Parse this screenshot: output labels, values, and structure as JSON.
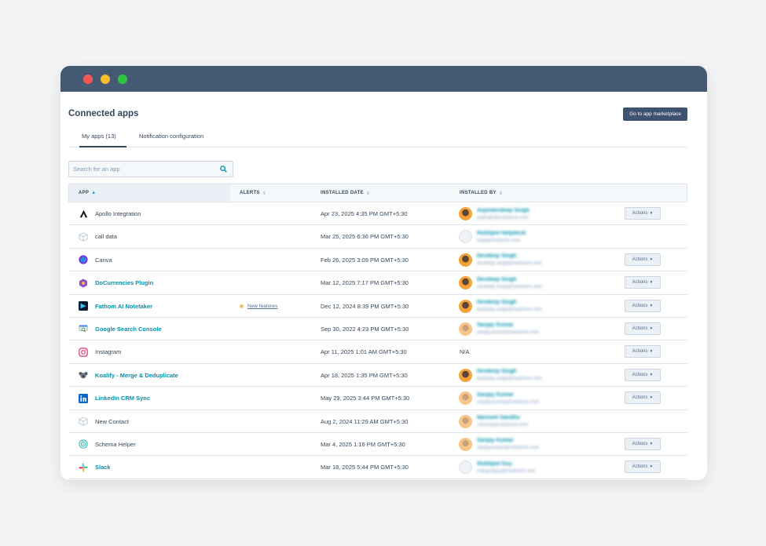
{
  "page": {
    "title": "Connected apps",
    "marketplace_button": "Go to app marketplace"
  },
  "tabs": [
    {
      "label": "My apps (13)",
      "active": true
    },
    {
      "label": "Notification configuration",
      "active": false
    }
  ],
  "search": {
    "placeholder": "Search for an app"
  },
  "table": {
    "headers": {
      "app": "APP",
      "alerts": "ALERTS",
      "installed_date": "INSTALLED DATE",
      "installed_by": "INSTALLED BY"
    },
    "sort": {
      "column": "app",
      "direction": "ascending"
    },
    "action_label": "Actions",
    "rows": [
      {
        "icon": "apollo-icon",
        "name": "Apollo Integration",
        "link": false,
        "alert": "",
        "date": "Apr 23, 2025 4:35 PM GMT+5:30",
        "by_name": "Arpinderdeep Singh",
        "by_email": "arpinder@martechs.com",
        "by_na": "",
        "avatar": "orange",
        "actions": true
      },
      {
        "icon": "cube-icon",
        "name": "call data",
        "link": false,
        "alert": "",
        "date": "Mar 25, 2025 6:36 PM GMT+5:30",
        "by_name": "HubSpot Helpdesk",
        "by_email": "help@martechs.com",
        "by_na": "",
        "avatar": "gray",
        "actions": false
      },
      {
        "icon": "canva-icon",
        "name": "Canva",
        "link": false,
        "alert": "",
        "date": "Feb 26, 2025 3:09 PM GMT+5:30",
        "by_name": "Devdeep Singh",
        "by_email": "devdeep.singh@martechs.com",
        "by_na": "",
        "avatar": "orange",
        "actions": true
      },
      {
        "icon": "docurrencies-icon",
        "name": "DoCurrencies Plugin",
        "link": true,
        "alert": "",
        "date": "Mar 12, 2025 7:17 PM GMT+5:30",
        "by_name": "Devdeep Singh",
        "by_email": "devdeep.singh@martechs.com",
        "by_na": "",
        "avatar": "orange",
        "actions": true
      },
      {
        "icon": "fathom-icon",
        "name": "Fathom AI Notetaker",
        "link": true,
        "alert": "New features",
        "date": "Dec 12, 2024 8:39 PM GMT+5:30",
        "by_name": "Devdeep Singh",
        "by_email": "devdeep.singh@martechs.com",
        "by_na": "",
        "avatar": "orange",
        "actions": true
      },
      {
        "icon": "google-search-console-icon",
        "name": "Google Search Console",
        "link": true,
        "alert": "",
        "date": "Sep 30, 2022 4:23 PM GMT+5:30",
        "by_name": "Sanjay Kumar",
        "by_email": "sanjay.kumar@martechs.com",
        "by_na": "",
        "avatar": "peach",
        "actions": true
      },
      {
        "icon": "instagram-icon",
        "name": "Instagram",
        "link": false,
        "alert": "",
        "date": "Apr 11, 2025 1:01 AM GMT+5:30",
        "by_name": "",
        "by_email": "",
        "by_na": "N/A",
        "avatar": "",
        "actions": true
      },
      {
        "icon": "koalify-icon",
        "name": "Koalify - Merge & Deduplicate",
        "link": true,
        "alert": "",
        "date": "Apr 18, 2025 1:35 PM GMT+5:30",
        "by_name": "Devdeep Singh",
        "by_email": "devdeep.singh@martechs.com",
        "by_na": "",
        "avatar": "orange",
        "actions": true
      },
      {
        "icon": "linkedin-icon",
        "name": "LinkedIn CRM Sync",
        "link": true,
        "alert": "",
        "date": "May 29, 2025 3:44 PM GMT+5:30",
        "by_name": "Sanjay Kumar",
        "by_email": "sanjay.kumar@martechs.com",
        "by_na": "",
        "avatar": "peach",
        "actions": true
      },
      {
        "icon": "cube-icon",
        "name": "New Contact",
        "link": false,
        "alert": "",
        "date": "Aug 2, 2024 11:29 AM GMT+5:30",
        "by_name": "Navneet Sandhu",
        "by_email": "navneet@martechs.com",
        "by_na": "",
        "avatar": "peach",
        "actions": false
      },
      {
        "icon": "schema-helper-icon",
        "name": "Schema Helper",
        "link": false,
        "alert": "",
        "date": "Mar 4, 2025 1:16 PM GMT+5:30",
        "by_name": "Sanjay Kumar",
        "by_email": "sanjay.kumar@martechs.com",
        "by_na": "",
        "avatar": "peach",
        "actions": true
      },
      {
        "icon": "slack-icon",
        "name": "Slack",
        "link": true,
        "alert": "",
        "date": "Mar 18, 2025 5:44 PM GMT+5:30",
        "by_name": "HubSpot Guy",
        "by_email": "hubspotguy@martechs.com",
        "by_na": "",
        "avatar": "gray",
        "actions": true
      }
    ]
  },
  "colors": {
    "titlebar": "#445a72",
    "link": "#0091ae",
    "text": "#33475b",
    "button": "#3e5370"
  }
}
